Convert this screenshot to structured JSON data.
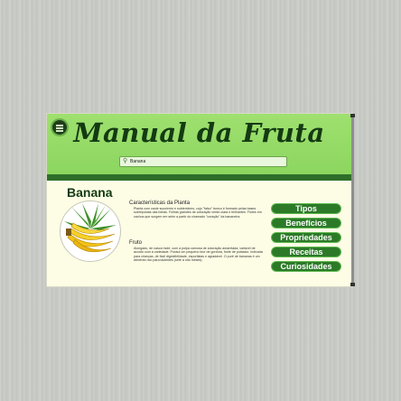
{
  "app": {
    "title": "Manual da Fruta"
  },
  "search": {
    "value": "Banana",
    "icon": "search-icon"
  },
  "fruit": {
    "name": "Banana",
    "image_icon": "banana-illustration"
  },
  "sections": [
    {
      "heading": "Características da Planta",
      "text": "Planta com caule suculento e subterrâneo, cujo \"falso\" tronco é formado pelas bases sobrepostas das folhas. Folhas grandes de coloração verde-clara e brilhantes. Flores em cachos que surgem em série a partir do chamado \"coração\" da bananeira."
    },
    {
      "heading": "Fruto",
      "text": "Alongado, de casca mole, com a polpa carnosa de coloração amarelada, variável de acordo com a variedade. Possui um pequeno teor de gordura, fonte de potássio. Indicada para crianças, de fácil digestibilidade, esportistas e agradável. O purê de bananas é um alimento rico para lactentes (sete a oito meses)."
    }
  ],
  "nav": [
    "Tipos",
    "Benefícios",
    "Propriedades",
    "Receitas",
    "Curiosidades"
  ],
  "colors": {
    "header_green": "#8cd660",
    "dark_green": "#2f6e2a",
    "button_green": "#2c7a28",
    "content_bg": "#fdfde6"
  }
}
